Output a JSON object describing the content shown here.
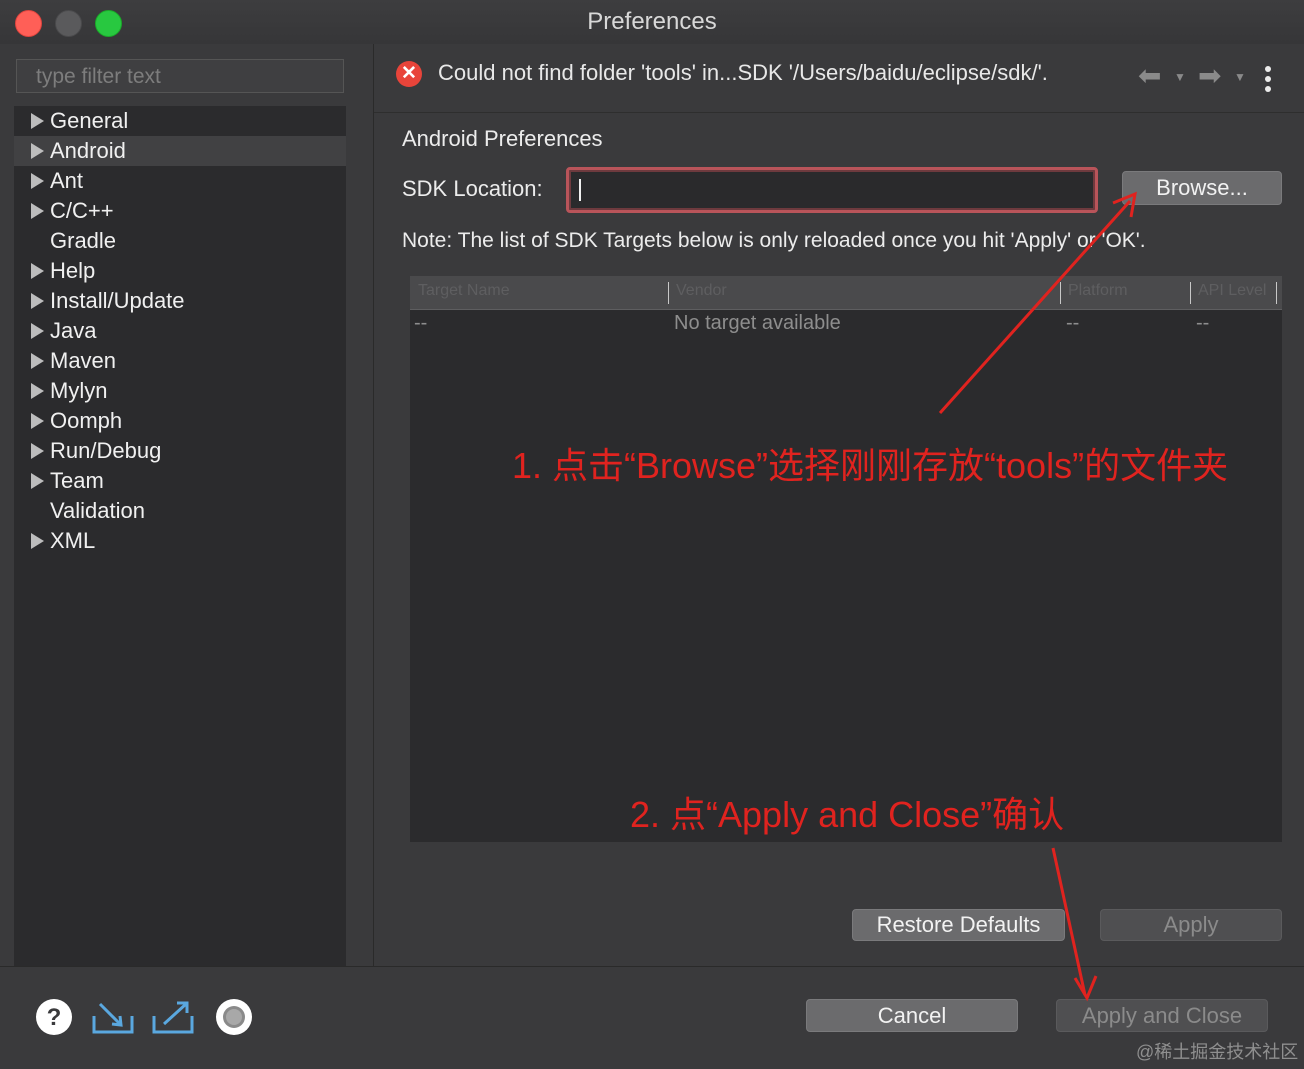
{
  "window": {
    "title": "Preferences"
  },
  "sidebar": {
    "filter_placeholder": "type filter text",
    "items": [
      {
        "label": "General",
        "expandable": true,
        "selected": false
      },
      {
        "label": "Android",
        "expandable": true,
        "selected": true
      },
      {
        "label": "Ant",
        "expandable": true,
        "selected": false
      },
      {
        "label": "C/C++",
        "expandable": true,
        "selected": false
      },
      {
        "label": "Gradle",
        "expandable": false,
        "selected": false
      },
      {
        "label": "Help",
        "expandable": true,
        "selected": false
      },
      {
        "label": "Install/Update",
        "expandable": true,
        "selected": false
      },
      {
        "label": "Java",
        "expandable": true,
        "selected": false
      },
      {
        "label": "Maven",
        "expandable": true,
        "selected": false
      },
      {
        "label": "Mylyn",
        "expandable": true,
        "selected": false
      },
      {
        "label": "Oomph",
        "expandable": true,
        "selected": false
      },
      {
        "label": "Run/Debug",
        "expandable": true,
        "selected": false
      },
      {
        "label": "Team",
        "expandable": true,
        "selected": false
      },
      {
        "label": "Validation",
        "expandable": false,
        "selected": false
      },
      {
        "label": "XML",
        "expandable": true,
        "selected": false
      }
    ]
  },
  "error": {
    "icon": "error-circle-icon",
    "message": "Could not find folder 'tools' in...SDK '/Users/baidu/eclipse/sdk/'."
  },
  "nav": {
    "back_icon": "back-arrow-icon",
    "forward_icon": "forward-arrow-icon",
    "menu_icon": "kebab-menu-icon"
  },
  "page": {
    "title": "Android Preferences",
    "sdk_label": "SDK Location:",
    "sdk_value": "",
    "browse_label": "Browse...",
    "note": "Note: The list of SDK Targets below is only reloaded once you hit 'Apply' or 'OK'."
  },
  "table": {
    "columns": [
      "Target Name",
      "Vendor",
      "Platform",
      "API Level"
    ],
    "row": [
      "--",
      "No target available",
      "--",
      "--"
    ]
  },
  "buttons": {
    "restore_defaults": "Restore Defaults",
    "apply": "Apply",
    "cancel": "Cancel",
    "apply_close": "Apply and Close"
  },
  "footer_icons": [
    "help-icon",
    "import-icon",
    "export-icon",
    "record-icon"
  ],
  "annotations": {
    "step1": "1. 点击“Browse”选择刚刚存放“tools”的文件夹",
    "step2": "2. 点“Apply and Close”确认",
    "color": "#e0231f"
  },
  "watermark": "@稀土掘金技术社区",
  "colors": {
    "error": "#e8443a",
    "focus_border": "#b9545a"
  }
}
